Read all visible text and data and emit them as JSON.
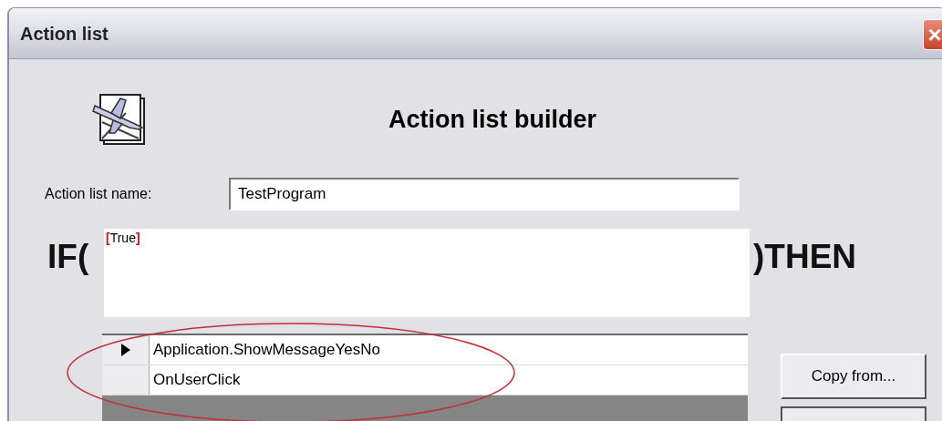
{
  "window": {
    "title": "Action list",
    "close": "×"
  },
  "heading": "Action list builder",
  "name_field": {
    "label": "Action list name:",
    "value": "TestProgram"
  },
  "condition": {
    "prefix": "IF(",
    "suffix": ")THEN",
    "tokens": [
      {
        "kind": "bracket",
        "text": "["
      },
      {
        "kind": "value",
        "text": "True"
      },
      {
        "kind": "bracket",
        "text": "]"
      }
    ]
  },
  "grid": {
    "rows": [
      {
        "text": "Application.ShowMessageYesNo",
        "selected": true
      },
      {
        "text": "OnUserClick",
        "selected": false
      }
    ]
  },
  "buttons": [
    "Copy from..."
  ]
}
